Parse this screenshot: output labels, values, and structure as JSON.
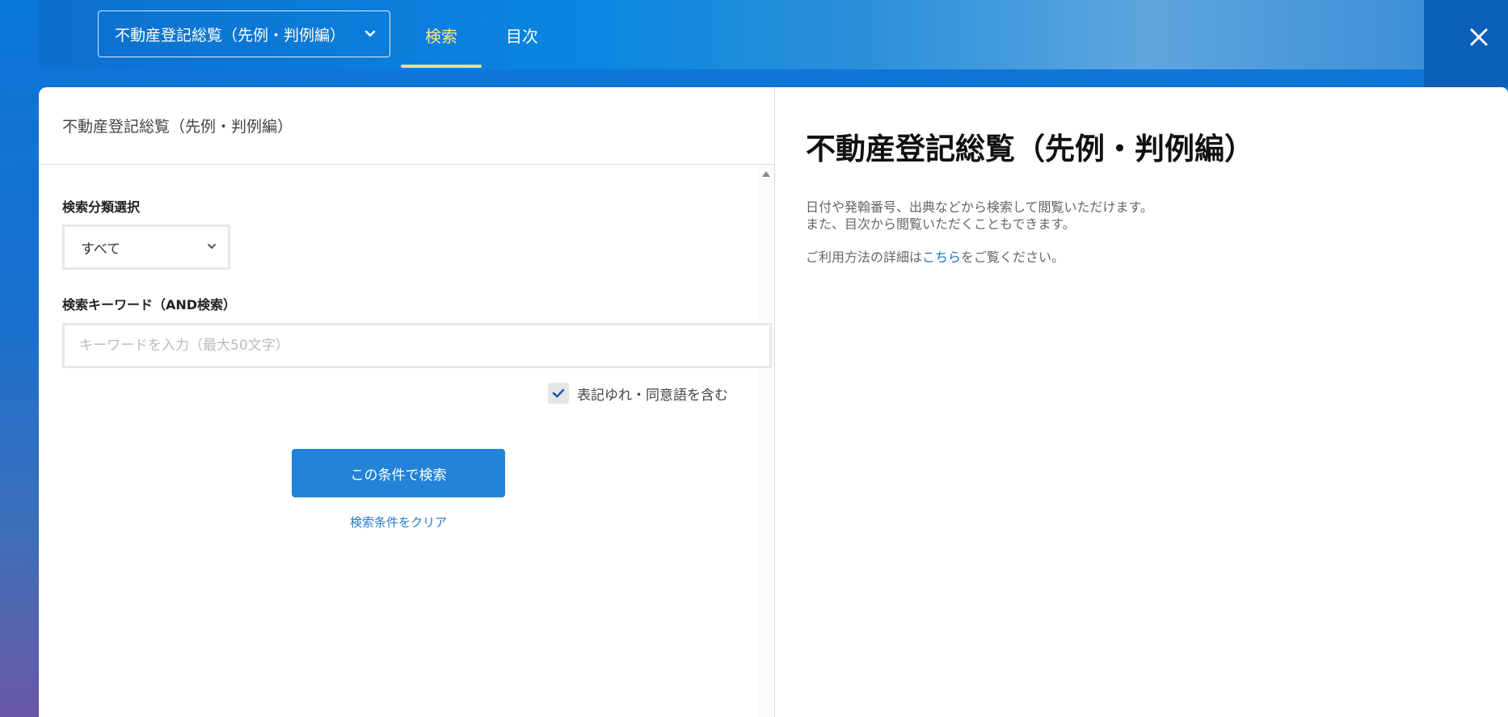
{
  "header": {
    "book_title": "不動産登記総覧（先例・判例編）",
    "tabs": [
      {
        "label": "検索",
        "active": true
      },
      {
        "label": "目次",
        "active": false
      }
    ],
    "close_icon": "close-icon"
  },
  "search_panel": {
    "header_title": "不動産登記総覧（先例・判例編）",
    "category_label": "検索分類選択",
    "category_value": "すべて",
    "keyword_label": "検索キーワード（AND検索）",
    "keyword_placeholder": "キーワードを入力（最大50文字）",
    "keyword_value": "",
    "synonym_label": "表記ゆれ・同意語を含む",
    "synonym_checked": true,
    "search_button": "この条件で検索",
    "clear_link": "検索条件をクリア"
  },
  "info_panel": {
    "title": "不動産登記総覧（先例・判例編）",
    "desc_line1": "日付や発翰番号、出典などから検索して閲覧いただけます。",
    "desc_line2": "また、目次から閲覧いただくこともできます。",
    "usage_prefix": "ご利用方法の詳細は",
    "usage_link": "こちら",
    "usage_suffix": "をご覧ください。"
  },
  "colors": {
    "accent": "#2283d8",
    "tab_active": "#ffe58a",
    "link": "#1f73c4"
  }
}
